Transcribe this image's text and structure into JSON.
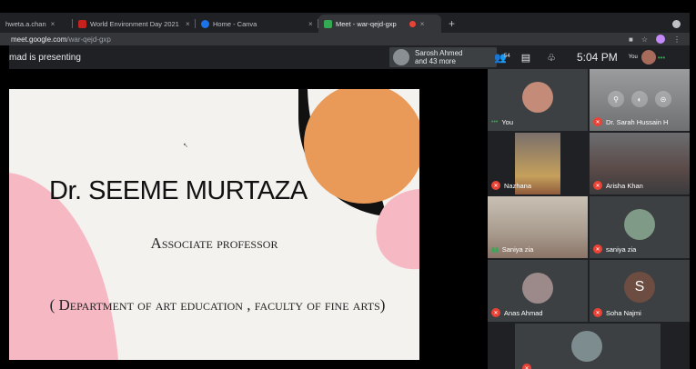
{
  "browser": {
    "tabs": [
      {
        "title": "hweta.a.chan",
        "close": "×",
        "color": "#5f6368"
      },
      {
        "title": "World Environment Day 2021",
        "close": "×",
        "color": "#c5221f"
      },
      {
        "title": "Home - Canva",
        "close": "×",
        "color": "#1a73e8"
      },
      {
        "title": "Meet - war-qejd-gxp",
        "close": "×",
        "color": "#34a853"
      }
    ],
    "new_tab": "+",
    "url_host": "meet.google.com",
    "url_path": "/war-qejd-gxp"
  },
  "meet": {
    "presenting": "mad is presenting",
    "presenter_name": "Sarosh Ahmed",
    "presenter_more": "and 43 more",
    "people_count": "54",
    "time": "5:04 PM",
    "you_label": "You"
  },
  "slide": {
    "title": "Dr. SEEME MURTAZA",
    "subtitle": "Associate professor",
    "department": "( Department of art education , faculty of fine arts)"
  },
  "participants": [
    {
      "name": "You",
      "muted": false
    },
    {
      "name": "Dr. Sarah Hussain H",
      "muted": true
    },
    {
      "name": "Nazhana",
      "muted": true
    },
    {
      "name": "Arisha Khan",
      "muted": true
    },
    {
      "name": "Saniya zia",
      "muted": false,
      "speaking": true
    },
    {
      "name": "saniya zia",
      "muted": true
    },
    {
      "name": "Anas Ahmad",
      "muted": true
    },
    {
      "name": "Soha Najmi",
      "muted": true,
      "initial": "S"
    }
  ],
  "colors": {
    "slide_bg": "#f4f2ef",
    "accent_orange": "#e99a58",
    "accent_pink": "#f6b9c4",
    "mute_red": "#ea4335",
    "meet_dark": "#202124"
  }
}
